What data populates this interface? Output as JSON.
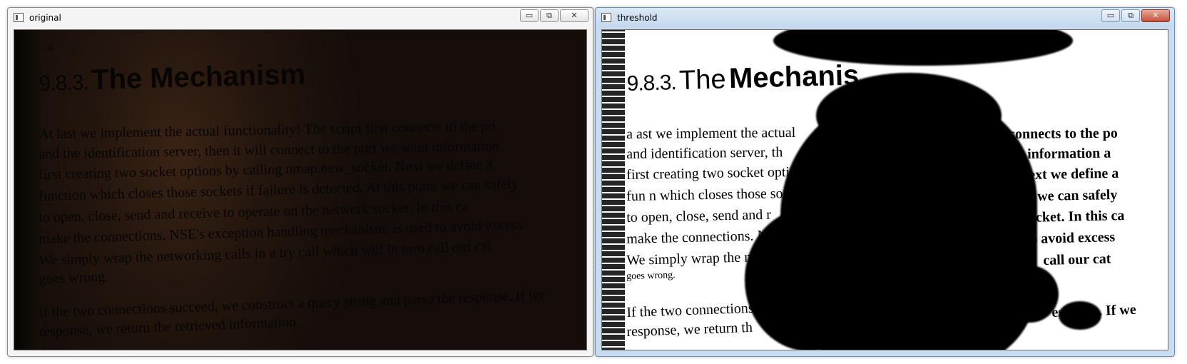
{
  "windows": {
    "original": {
      "title": "original",
      "buttons": {
        "minimize": "▭",
        "restore": "⧉",
        "close": "✕"
      }
    },
    "threshold": {
      "title": "threshold",
      "buttons": {
        "minimize": "▭",
        "restore": "⧉",
        "close": "✕"
      }
    }
  },
  "page_original": {
    "running_head": "cal.",
    "heading_number": "9.8.3.",
    "heading_text": "The Mechanism",
    "lines": [
      "At last we implement the actual functionality! The script first connects to the po",
      "and the identification server, then it will connect to the port we want information",
      "first creating two socket options by calling nmap.new_socket. Next we define a",
      "function which closes those sockets if failure is detected. At this point we can safely",
      "to open, close, send and receive to operate on the network socket. In this ca",
      "make the connections. NSE's exception handling mechanism, is used to avoid excess",
      "We simply wrap the networking calls in a try call which will in turn call our cat",
      "goes wrong.",
      "If the two connections succeed, we construct a query string and parse the response. If we",
      "response, we return the retrieved information."
    ]
  },
  "page_threshold": {
    "heading_number": "9.8.3.",
    "heading_text1": "The",
    "heading_text2": "Mechanis",
    "lines": [
      "a ast we implement the actual",
      "and identification server, th",
      "first creating two socket option",
      "fun n which closes those so",
      "to open, close, send and r",
      "make the connections. NSE",
      "We simply wrap the networ",
      "goes wrong.",
      "If the two connections s",
      "response, we return th"
    ],
    "right_lines": [
      "connects to the po",
      "information a",
      "ext we define a",
      "we can safely",
      "socket. In this ca",
      "o avoid excess",
      "call our cat",
      "",
      "esponse. If we",
      ""
    ]
  }
}
